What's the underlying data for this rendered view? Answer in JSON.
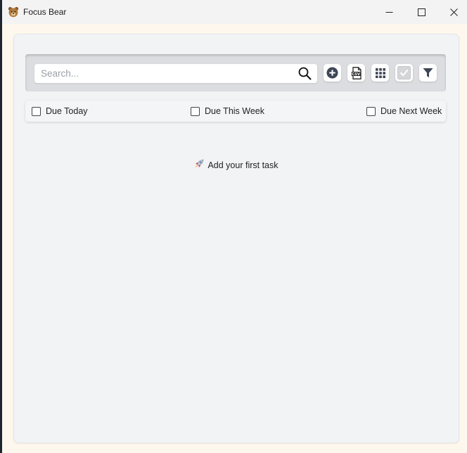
{
  "window": {
    "title": "Focus Bear",
    "app_icon": "bear-icon",
    "controls": [
      "minimize-icon",
      "maximize-icon",
      "close-icon"
    ]
  },
  "toolbar": {
    "search_placeholder": "Search...",
    "search_value": "",
    "buttons": [
      {
        "name": "add-task-button",
        "icon": "plus-circle-icon"
      },
      {
        "name": "csv-export-button",
        "icon": "csv-file-icon"
      },
      {
        "name": "grid-view-button",
        "icon": "grid-icon"
      },
      {
        "name": "select-all-button",
        "icon": "check-icon"
      },
      {
        "name": "filter-button",
        "icon": "filter-icon"
      }
    ]
  },
  "filters": {
    "due_today": "Due Today",
    "due_this_week": "Due This Week",
    "due_next_week": "Due Next Week"
  },
  "empty_state": {
    "icon": "rocket-icon",
    "text": "Add your first task"
  },
  "colors": {
    "title_bar": "#f3f3f3",
    "panel": "#f2f3f5",
    "toolbar": "#dcdde0",
    "icon_dark": "#3d4655"
  }
}
